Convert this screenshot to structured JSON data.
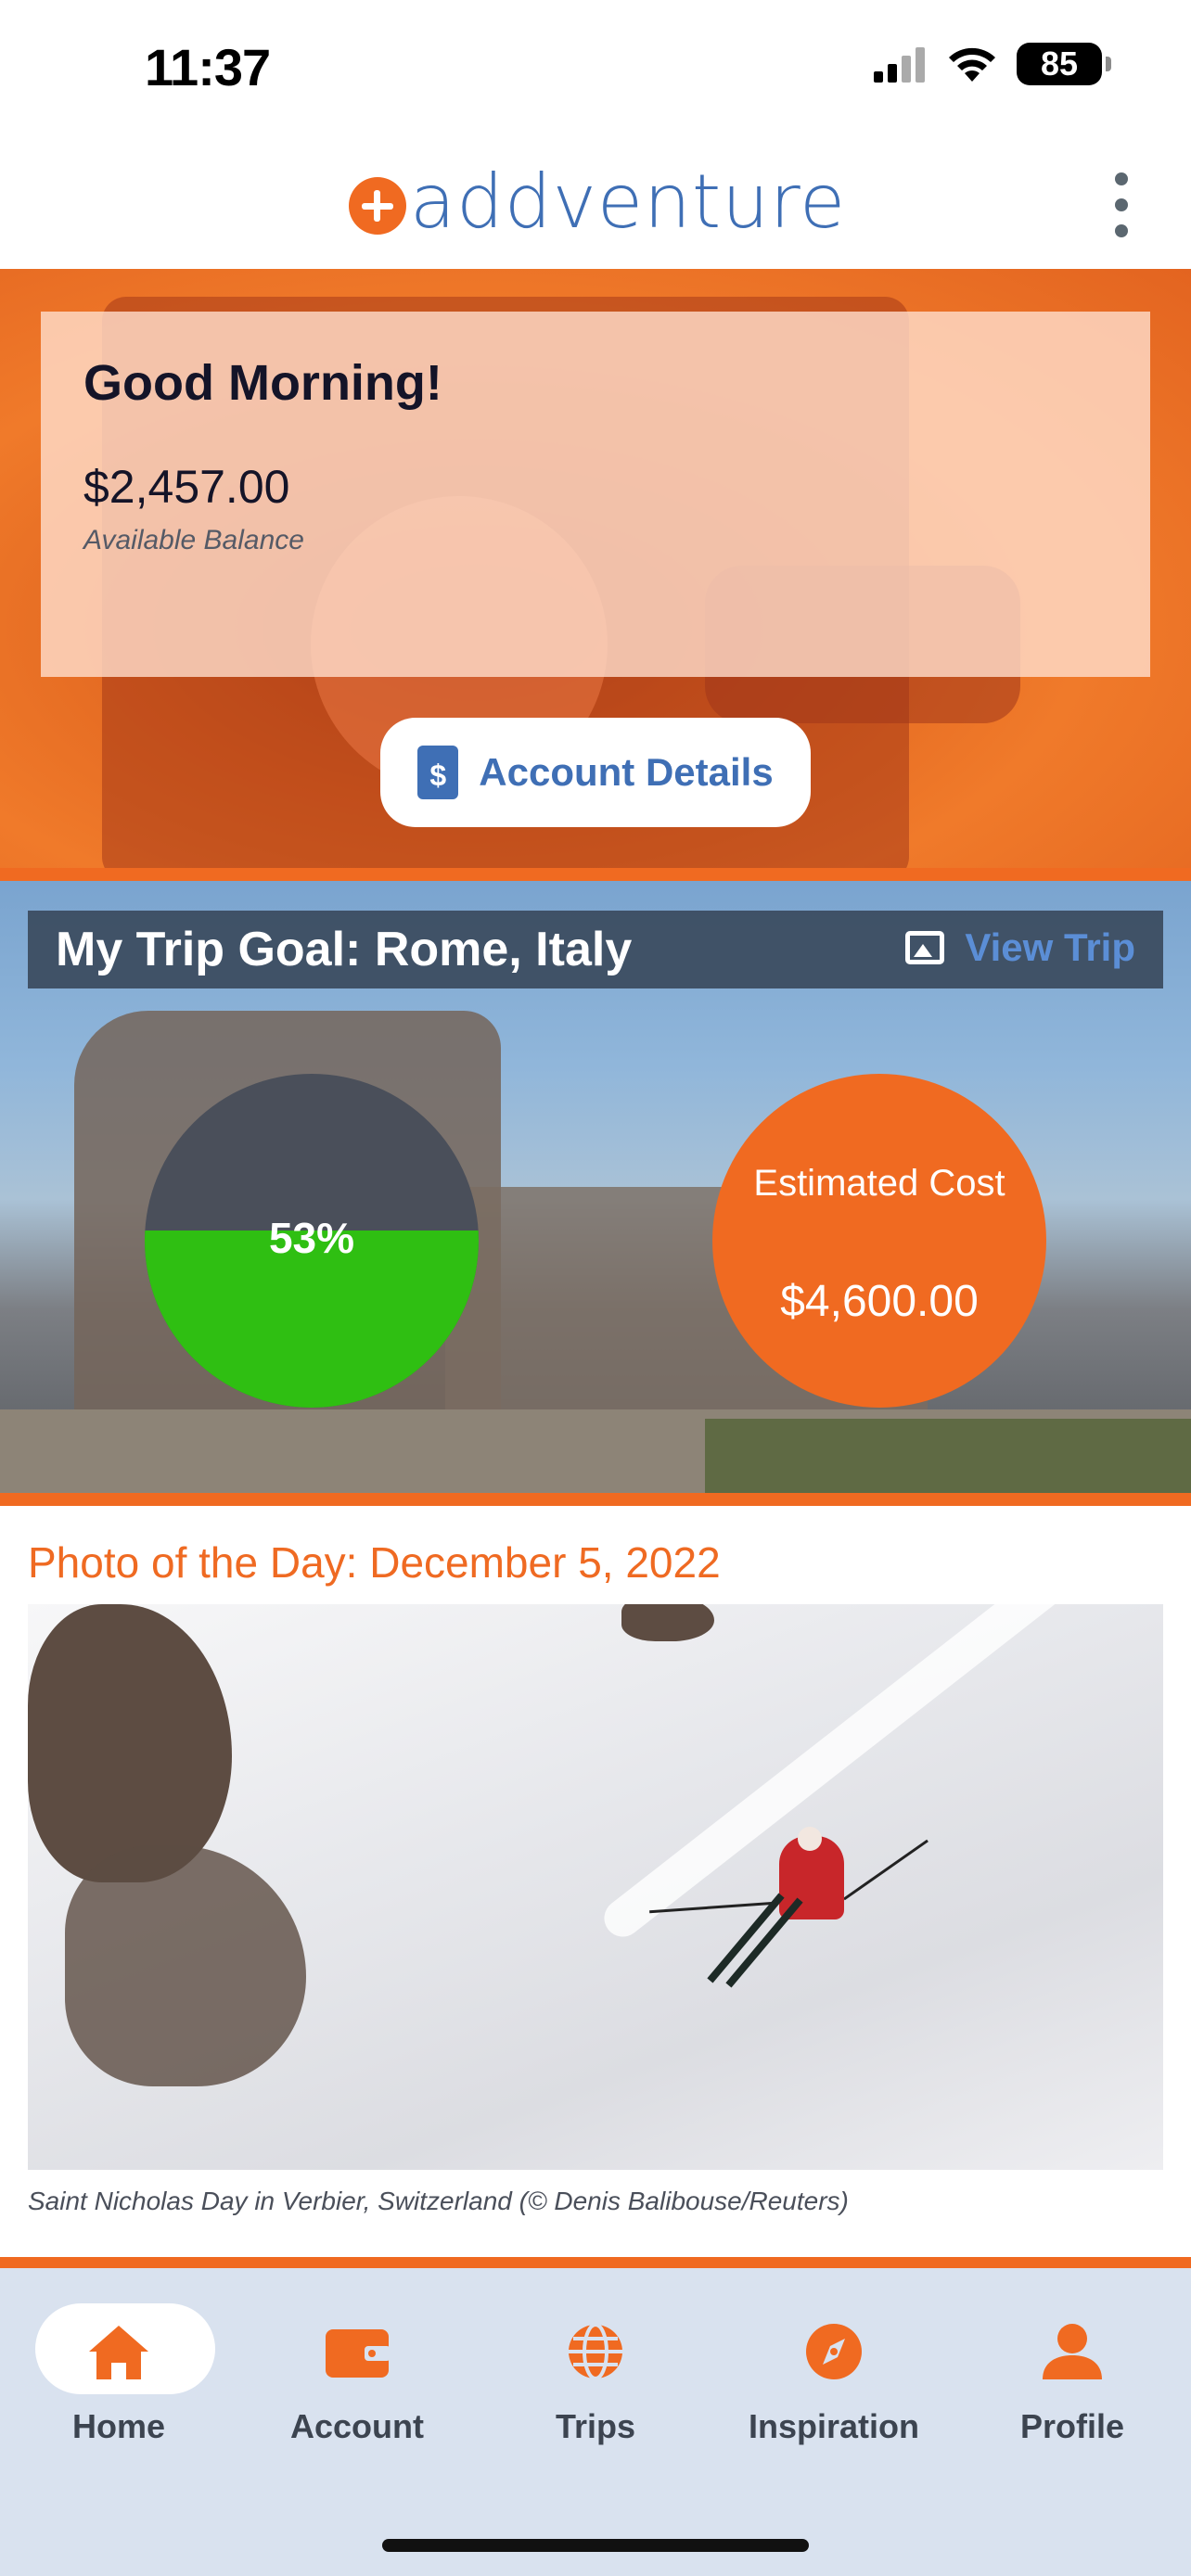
{
  "status_bar": {
    "time": "11:37",
    "battery": "85",
    "icons": [
      "cellular-signal-icon",
      "wifi-icon",
      "battery-icon"
    ]
  },
  "header": {
    "logo_text": "addventure",
    "logo_icon": "plus-circle-icon",
    "menu_icon": "more-vertical-icon"
  },
  "colors": {
    "brand_orange": "#f06a21",
    "brand_blue": "#3f6fb5",
    "progress_green": "#2fbf12"
  },
  "hero": {
    "greeting": "Good Morning!",
    "balance": "$2,457.00",
    "balance_label": "Available Balance",
    "account_button": "Account Details",
    "account_icon": "document-dollar-icon"
  },
  "trip": {
    "title": "My Trip Goal: Rome, Italy",
    "view_trip": "View Trip",
    "view_trip_icon": "image-icon",
    "progress_percent": 53,
    "progress_label": "53%",
    "cost_label": "Estimated Cost",
    "cost_value": "$4,600.00"
  },
  "photo_of_day": {
    "title": "Photo of the Day: December 5, 2022",
    "caption": "Saint Nicholas Day in Verbier, Switzerland (© Denis Balibouse/Reuters)"
  },
  "nav": {
    "active": "Home",
    "items": [
      {
        "label": "Home",
        "icon": "home-icon"
      },
      {
        "label": "Account",
        "icon": "wallet-icon"
      },
      {
        "label": "Trips",
        "icon": "globe-icon"
      },
      {
        "label": "Inspiration",
        "icon": "compass-icon"
      },
      {
        "label": "Profile",
        "icon": "user-icon"
      }
    ]
  }
}
